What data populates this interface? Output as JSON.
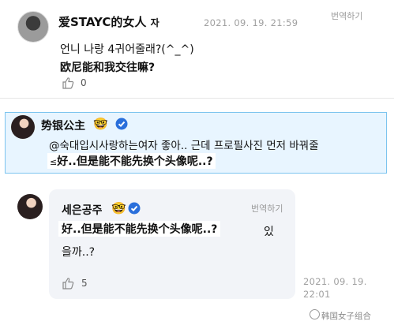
{
  "comment1": {
    "author": "爱STAYC的女人",
    "author_suffix": "자",
    "timestamp": "2021. 09. 19. 21:59",
    "translate_label": "번역하기",
    "text_korean": "언니 나랑 4귀어줄래?(^_^)",
    "text_chinese": "欧尼能和我交往嘛?",
    "likes": "0"
  },
  "comment2": {
    "author": "势银公主",
    "emoji": "🤓",
    "text_korean": "@숙대입시사랑하는여자 좋아.. 근데 프로필사진 먼저 바꿔줄",
    "text_chinese_prefix": "≤",
    "text_chinese": "好..但是能不能先换个头像呢..?"
  },
  "comment3": {
    "author": "세은공주",
    "emoji": "🤓",
    "translate_label": "번역하기",
    "text_chinese": "好..但是能不能先换个头像呢..?",
    "text_korean_tail": "있",
    "text_korean_line2": "을까..?",
    "likes": "5",
    "timestamp_line1": "2021. 09. 19.",
    "timestamp_line2": "22:01"
  },
  "watermark": "韩国女子组合",
  "icons": {
    "like": "thumbs-up-icon",
    "verified": "verified-badge-icon"
  },
  "colors": {
    "highlight_bg": "#e8f5ff",
    "highlight_border": "#7cc4ef",
    "card_bg": "#f2f4f8",
    "verified": "#2a6fdb"
  }
}
